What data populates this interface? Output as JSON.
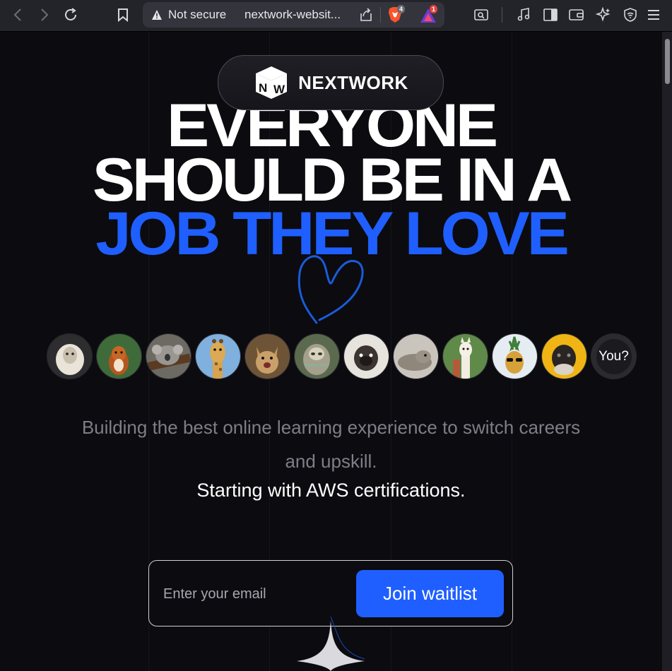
{
  "browser": {
    "security_label": "Not secure",
    "url": "nextwork-websit...",
    "brave_badge_count": "4",
    "alert_badge_count": "1"
  },
  "logo": {
    "mark_letters": "NW",
    "name": "NEXTWORK"
  },
  "hero": {
    "line1": "EVERYONE",
    "line2": "SHOULD BE IN A",
    "line3": "JOB THEY LOVE",
    "accent_color": "#1f5fff"
  },
  "avatars": {
    "items": [
      "sheep",
      "squirrel",
      "koala",
      "giraffe",
      "cat",
      "sloth",
      "pug",
      "seal",
      "alpaca",
      "pineapple",
      "pug-yellow"
    ],
    "you_label": "You?"
  },
  "intro": {
    "text": "Building the best online learning experience to switch careers",
    "text_line2": "and upskill.",
    "highlight": "Starting with AWS certifications."
  },
  "waitlist": {
    "email_placeholder": "Enter your email",
    "button_label": "Join waitlist"
  }
}
